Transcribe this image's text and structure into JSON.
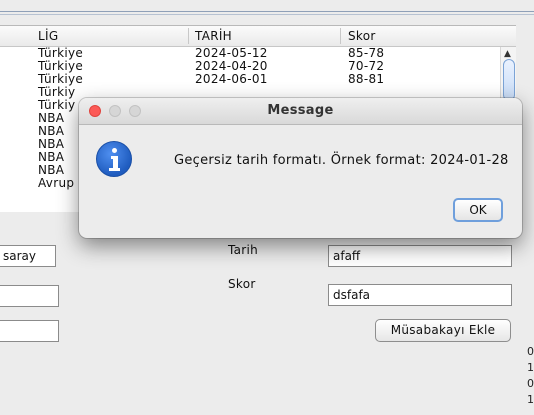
{
  "table": {
    "headers": [
      "LİG",
      "TARİH",
      "Skor"
    ],
    "rows": [
      [
        "Türkiye",
        "2024-05-12",
        "85-78"
      ],
      [
        "Türkiye",
        "2024-04-20",
        "70-72"
      ],
      [
        "Türkiye",
        "2024-06-01",
        "88-81"
      ],
      [
        "Türkiy",
        "",
        ""
      ],
      [
        "Türkiy",
        "",
        ""
      ],
      [
        "NBA",
        "",
        ""
      ],
      [
        "NBA",
        "",
        ""
      ],
      [
        "NBA",
        "",
        ""
      ],
      [
        "NBA",
        "",
        ""
      ],
      [
        "NBA",
        "",
        ""
      ],
      [
        "Avrup",
        "",
        ""
      ]
    ]
  },
  "form": {
    "team_field_value": "saray",
    "date_label": "Tarih",
    "date_value": "afaff",
    "score_label": "Skor",
    "score_value": "dsfafa",
    "add_button_label": "Müsabakayı Ekle"
  },
  "edge_digits": [
    "0",
    "1",
    "0",
    "1"
  ],
  "dialog": {
    "title": "Message",
    "message": "Geçersiz tarih formatı. Örnek format: 2024-01-28",
    "ok_label": "OK",
    "icon": "info-icon"
  },
  "colors": {
    "close_button": "#fc5a57",
    "info_icon": "#2a6fd6",
    "ok_border": "#6f9fdc"
  }
}
